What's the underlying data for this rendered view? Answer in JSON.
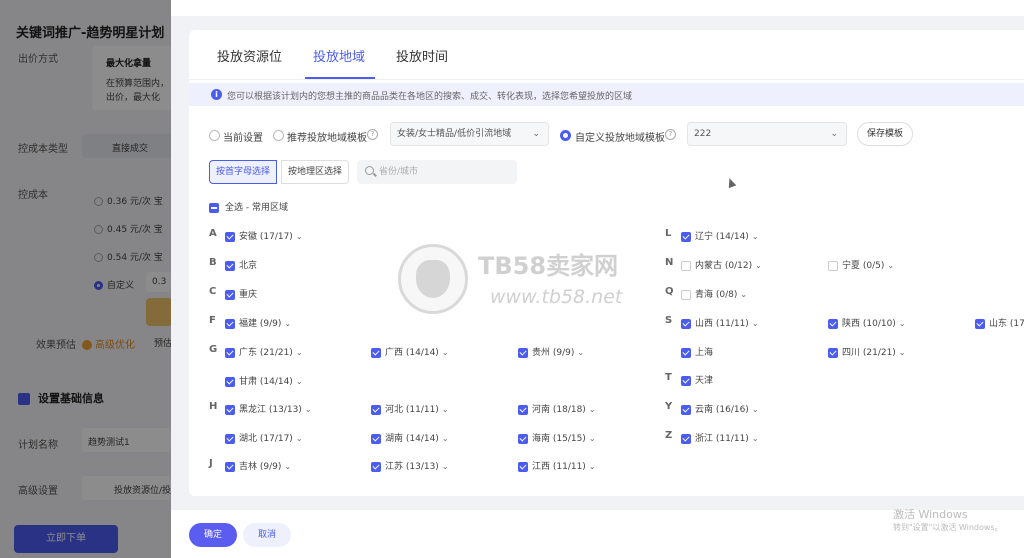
{
  "background": {
    "title": "关键词推广-趋势明星计划",
    "labels": {
      "bid_method": "出价方式",
      "cost_type": "控成本类型",
      "cost_control": "控成本",
      "effect": "效果预估",
      "basic_info": "设置基础信息",
      "plan_name": "计划名称",
      "advanced": "高级设置"
    },
    "max_value": "最大化拿量",
    "max_desc_1": "在预算范围内，",
    "max_desc_2": "出价，最大化",
    "direct_deal": "直接成交",
    "price_1": "0.36 元/次 宝",
    "price_2": "0.45 元/次 宝",
    "price_3": "0.54 元/次 宝",
    "custom": "自定义",
    "custom_value": "0.3",
    "effect_value": "高级优化",
    "effect_suffix": "预估",
    "plan_name_value": "趋势测试1",
    "advanced_value": "投放资源位/投",
    "submit": "立即下单"
  },
  "tabs": [
    "投放资源位",
    "投放地域",
    "投放时间"
  ],
  "info_text": "您可以根据该计划内的您想主推的商品品类在各地区的搜索、成交、转化表现，选择您希望投放的区域",
  "region_mode": {
    "options": [
      "当前设置",
      "推荐投放地域模板",
      "自定义投放地域模板"
    ],
    "recommend_select": "女装/女士精品/低价引流地域",
    "custom_select": "222",
    "save_template": "保存模板"
  },
  "segments": [
    "按首字母选择",
    "按地理区选择"
  ],
  "search": {
    "placeholder": "省份/城市"
  },
  "select_all": "全选 - 常用区域",
  "letters": [
    "A",
    "B",
    "C",
    "F",
    "G",
    "H",
    "J",
    "L",
    "N",
    "Q",
    "S",
    "T",
    "Y",
    "Z"
  ],
  "provinces": {
    "anhui": "安徽 (17/17)",
    "beijing": "北京",
    "chongqing": "重庆",
    "fujian": "福建 (9/9)",
    "guangdong": "广东 (21/21)",
    "guangxi": "广西 (14/14)",
    "guizhou": "贵州 (9/9)",
    "gansu": "甘肃 (14/14)",
    "heilongjiang": "黑龙江 (13/13)",
    "hebei": "河北 (11/11)",
    "henan": "河南 (18/18)",
    "hubei": "湖北 (17/17)",
    "hunan": "湖南 (14/14)",
    "hainan": "海南 (15/15)",
    "jilin": "吉林 (9/9)",
    "jiangsu": "江苏 (13/13)",
    "jiangxi": "江西 (11/11)",
    "liaoning": "辽宁 (14/14)",
    "neimenggu": "内蒙古 (0/12)",
    "ningxia": "宁夏 (0/5)",
    "qinghai": "青海 (0/8)",
    "shanxi": "山西 (11/11)",
    "shaanxi": "陕西 (10/10)",
    "shandong": "山东 (17",
    "shanghai": "上海",
    "sichuan": "四川 (21/21)",
    "tianjin": "天津",
    "yunnan": "云南 (16/16)",
    "zhejiang": "浙江 (11/11)"
  },
  "footer": {
    "ok": "确定",
    "cancel": "取消"
  },
  "watermark": {
    "brand": "TB58卖家网",
    "url": "www.tb58.net"
  },
  "windows": {
    "title": "激活 Windows",
    "subtitle": "转到\"设置\"以激活 Windows。"
  },
  "colors": {
    "accent": "#4b5cf0",
    "info_bg": "#eef0fe"
  }
}
